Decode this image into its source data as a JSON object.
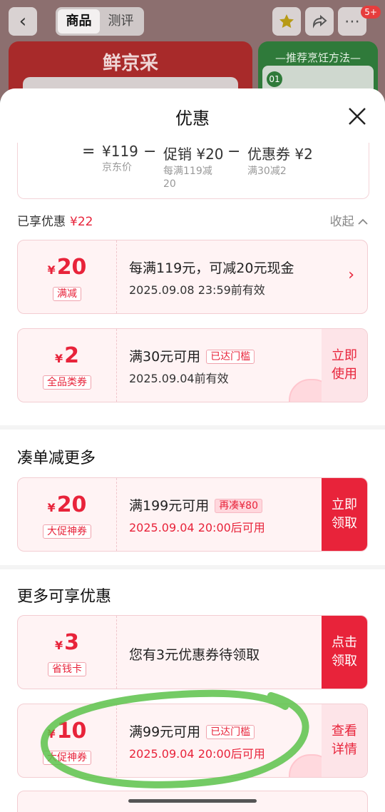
{
  "background": {
    "tabs": [
      "商品",
      "测评"
    ],
    "banner_title": "鲜京采",
    "banner_right_title": "—推荐烹饪方法—",
    "banner_right_step": "01",
    "cart_badge": "5+"
  },
  "sheet": {
    "title": "优惠",
    "calc": {
      "equals": "=",
      "minus": "−",
      "items": [
        {
          "main": "¥119",
          "sub": "京东价"
        },
        {
          "main": "促销 ¥20",
          "sub": "每满119减20"
        },
        {
          "main": "优惠券 ¥2",
          "sub": "满30减2"
        }
      ]
    },
    "enjoyed_label": "已享优惠",
    "enjoyed_amount": "¥22",
    "collapse_label": "收起",
    "coupons_enjoyed": [
      {
        "symbol": "¥",
        "amount": "20",
        "tag": "满减",
        "line1": "每满119元，可减20元现金",
        "line2": "2025.09.08 23:59前有效",
        "action": ""
      },
      {
        "symbol": "¥",
        "amount": "2",
        "tag": "全品类券",
        "line1": "满30元可用",
        "chip": "已达门槛",
        "line2": "2025.09.04前有效",
        "action": "立即使用"
      }
    ],
    "section_more_order": "凑单减更多",
    "coupon_more_order": {
      "symbol": "¥",
      "amount": "20",
      "tag": "大促神券",
      "line1": "满199元可用",
      "chip": "再凑¥80",
      "line2": "2025.09.04 20:00后可用",
      "action": "立即领取"
    },
    "section_more": "更多可享优惠",
    "coupons_more": [
      {
        "symbol": "¥",
        "amount": "3",
        "tag": "省钱卡",
        "line1": "您有3元优惠券待领取",
        "action": "点击领取"
      },
      {
        "symbol": "¥",
        "amount": "10",
        "tag": "大促神券",
        "line1": "满99元可用",
        "chip": "已达门槛",
        "line2": "2025.09.04 20:00后可用",
        "action": "查看详情"
      }
    ]
  },
  "colors": {
    "accent": "#e8233a",
    "annotation": "#5cc24a"
  }
}
